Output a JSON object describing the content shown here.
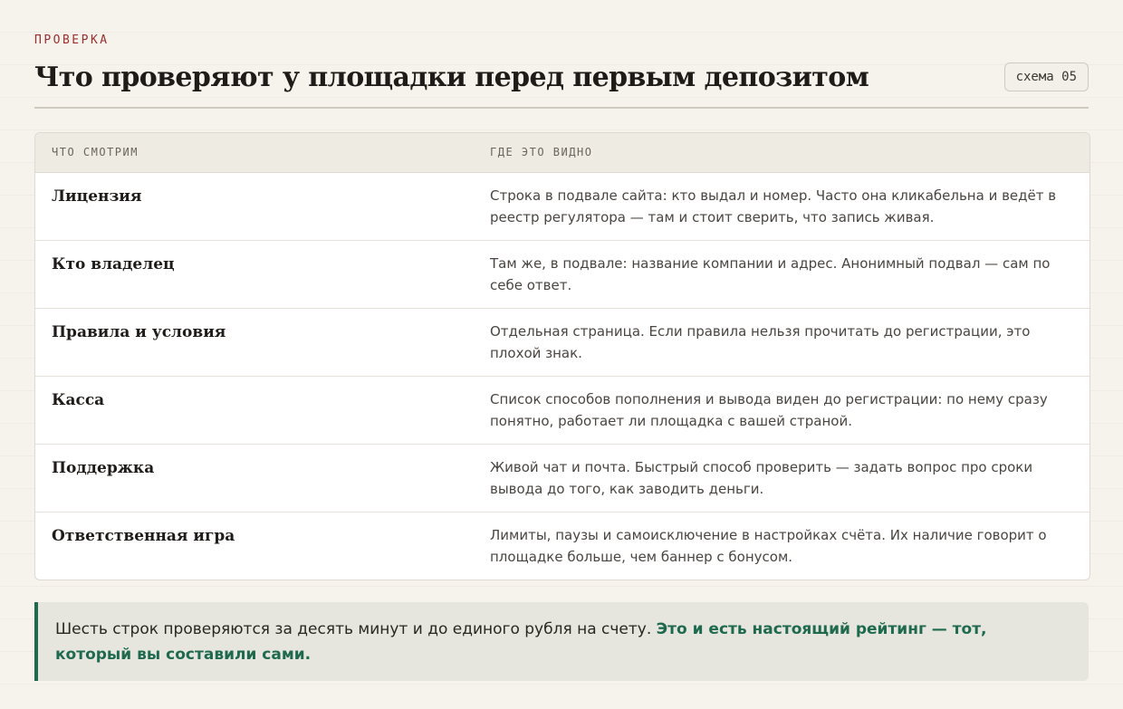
{
  "section": {
    "eyebrow": "ПРОВЕРКА",
    "title": "Что проверяют у площадки перед первым депозитом",
    "badge": "схема 05"
  },
  "table": {
    "headers": [
      "Что смотрим",
      "Где это видно"
    ],
    "rows": [
      {
        "key": "Лицензия",
        "value": "Строка в подвале сайта: кто выдал и номер. Часто она кликабельна и ведёт в реестр регулятора — там и стоит сверить, что запись живая."
      },
      {
        "key": "Кто владелец",
        "value": "Там же, в подвале: название компании и адрес. Анонимный подвал — сам по себе ответ."
      },
      {
        "key": "Правила и условия",
        "value": "Отдельная страница. Если правила нельзя прочитать до регистрации, это плохой знак."
      },
      {
        "key": "Касса",
        "value": "Список способов пополнения и вывода виден до регистрации: по нему сразу понятно, работает ли площадка с вашей страной."
      },
      {
        "key": "Поддержка",
        "value": "Живой чат и почта. Быстрый способ проверить — задать вопрос про сроки вывода до того, как заводить деньги."
      },
      {
        "key": "Ответственная игра",
        "value": "Лимиты, паузы и самоисключение в настройках счёта. Их наличие говорит о площадке больше, чем баннер с бонусом."
      }
    ]
  },
  "callout": {
    "text": "Шесть строк проверяются за десять минут и до единого рубля на счету.",
    "emphasis": "Это и есть настоящий рейтинг — тот, который вы составили сами."
  },
  "colors": {
    "accent_red": "#9a2f2f",
    "accent_green": "#1f6a4f",
    "background": "#f6f3ec"
  }
}
